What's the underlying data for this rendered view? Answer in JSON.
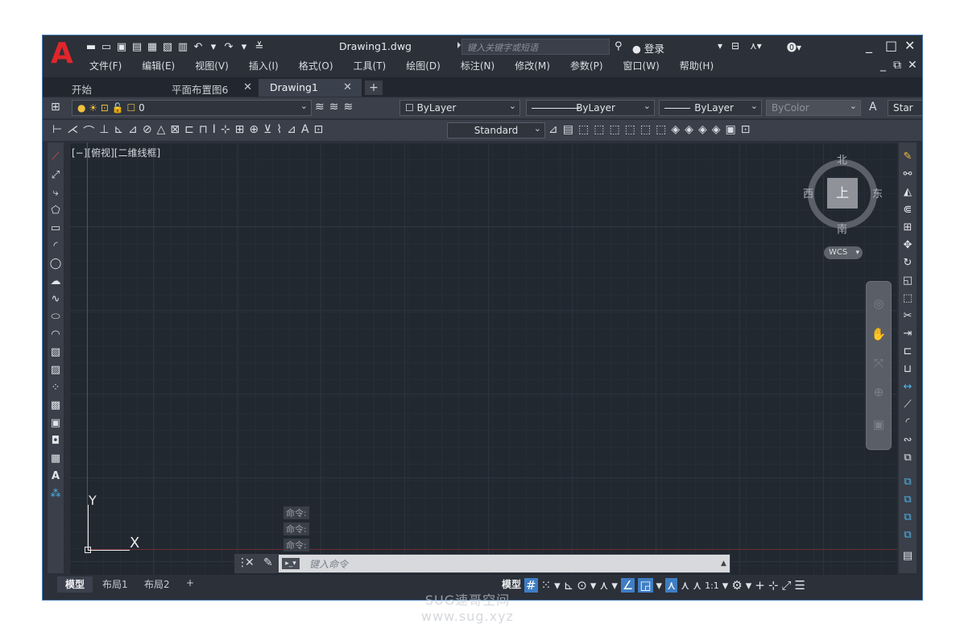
{
  "app": {
    "logo": "A",
    "document_title": "Drawing1.dwg",
    "search_placeholder": "键入关键字或短语",
    "login_label": "登录"
  },
  "menu": [
    "文件(F)",
    "编辑(E)",
    "视图(V)",
    "插入(I)",
    "格式(O)",
    "工具(T)",
    "绘图(D)",
    "标注(N)",
    "修改(M)",
    "参数(P)",
    "窗口(W)",
    "帮助(H)"
  ],
  "tabs": [
    {
      "label": "开始",
      "closable": false,
      "active": false
    },
    {
      "label": "平面布置图6",
      "closable": true,
      "active": false
    },
    {
      "label": "Drawing1",
      "closable": true,
      "active": true
    }
  ],
  "toolbar": {
    "layer_value": "0",
    "color_value": "ByLayer",
    "linetype_value": "ByLayer",
    "lineweight_value": "ByLayer",
    "plotstyle_value": "ByColor",
    "textstyle_value": "Star",
    "dimstyle_value": "Standard"
  },
  "viewport": {
    "label": "[−][俯视][二维线框]",
    "ucs_y": "Y",
    "ucs_x": "X"
  },
  "viewcube": {
    "north": "北",
    "south": "南",
    "west": "西",
    "east": "东",
    "face": "上",
    "wcs_label": "WCS"
  },
  "command": {
    "history": [
      "命令:",
      "命令:",
      "命令:"
    ],
    "placeholder": "键入命令"
  },
  "layout_tabs": [
    {
      "label": "模型",
      "active": true
    },
    {
      "label": "布局1",
      "active": false
    },
    {
      "label": "布局2",
      "active": false
    }
  ],
  "statusbar": {
    "model_label": "模型",
    "scale_label": "1:1"
  },
  "watermark": {
    "line1": "SUG速哥空间",
    "line2": "www.sug.xyz"
  },
  "colors": {
    "canvas": "#212830",
    "chrome": "#2b2f38",
    "accent": "#3f7ec4",
    "logo": "#e0262b"
  }
}
